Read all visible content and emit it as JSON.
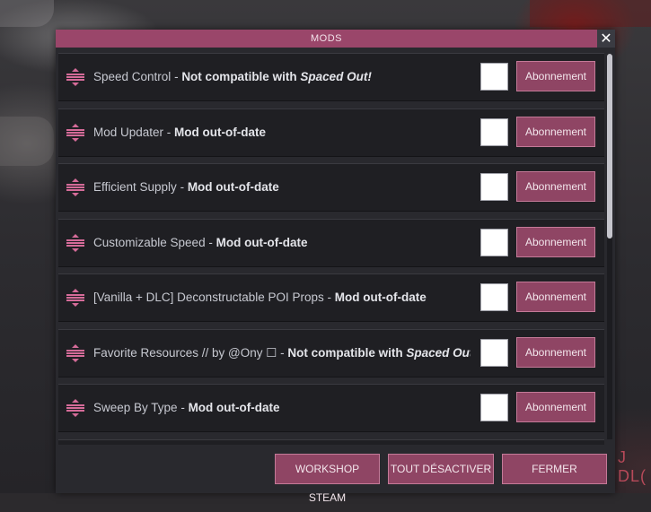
{
  "dialog": {
    "title": "MODS",
    "close_glyph": "✕",
    "close_icon": "close-icon",
    "accent_color": "#9a466a",
    "checkbox_state": "unchecked"
  },
  "mods": [
    {
      "name": "Speed Control",
      "sep": " - ",
      "status_pre": "Not compatible with ",
      "status_italic": "Spaced Out!",
      "button": "Abonnement"
    },
    {
      "name": "Mod Updater",
      "sep": " - ",
      "status_pre": "Mod out-of-date",
      "status_italic": "",
      "button": "Abonnement"
    },
    {
      "name": "Efficient Supply",
      "sep": " - ",
      "status_pre": "Mod out-of-date",
      "status_italic": "",
      "button": "Abonnement"
    },
    {
      "name": "Customizable Speed",
      "sep": " - ",
      "status_pre": "Mod out-of-date",
      "status_italic": "",
      "button": "Abonnement"
    },
    {
      "name": "[Vanilla + DLC] Deconstructable POI Props",
      "sep": " - ",
      "status_pre": "Mod out-of-date",
      "status_italic": "",
      "button": "Abonnement"
    },
    {
      "name": "Favorite Resources // by @Ony ☐",
      "sep": " - ",
      "status_pre": "Not compatible with ",
      "status_italic": "Spaced Out!",
      "button": "Abonnement"
    },
    {
      "name": "Sweep By Type",
      "sep": " - ",
      "status_pre": "Mod out-of-date",
      "status_italic": "",
      "button": "Abonnement"
    }
  ],
  "footer": {
    "workshop": "WORKSHOP STEAM",
    "disable_all": "TOUT DÉSACTIVER",
    "close": "FERMER"
  },
  "background": {
    "text": "J DL("
  }
}
